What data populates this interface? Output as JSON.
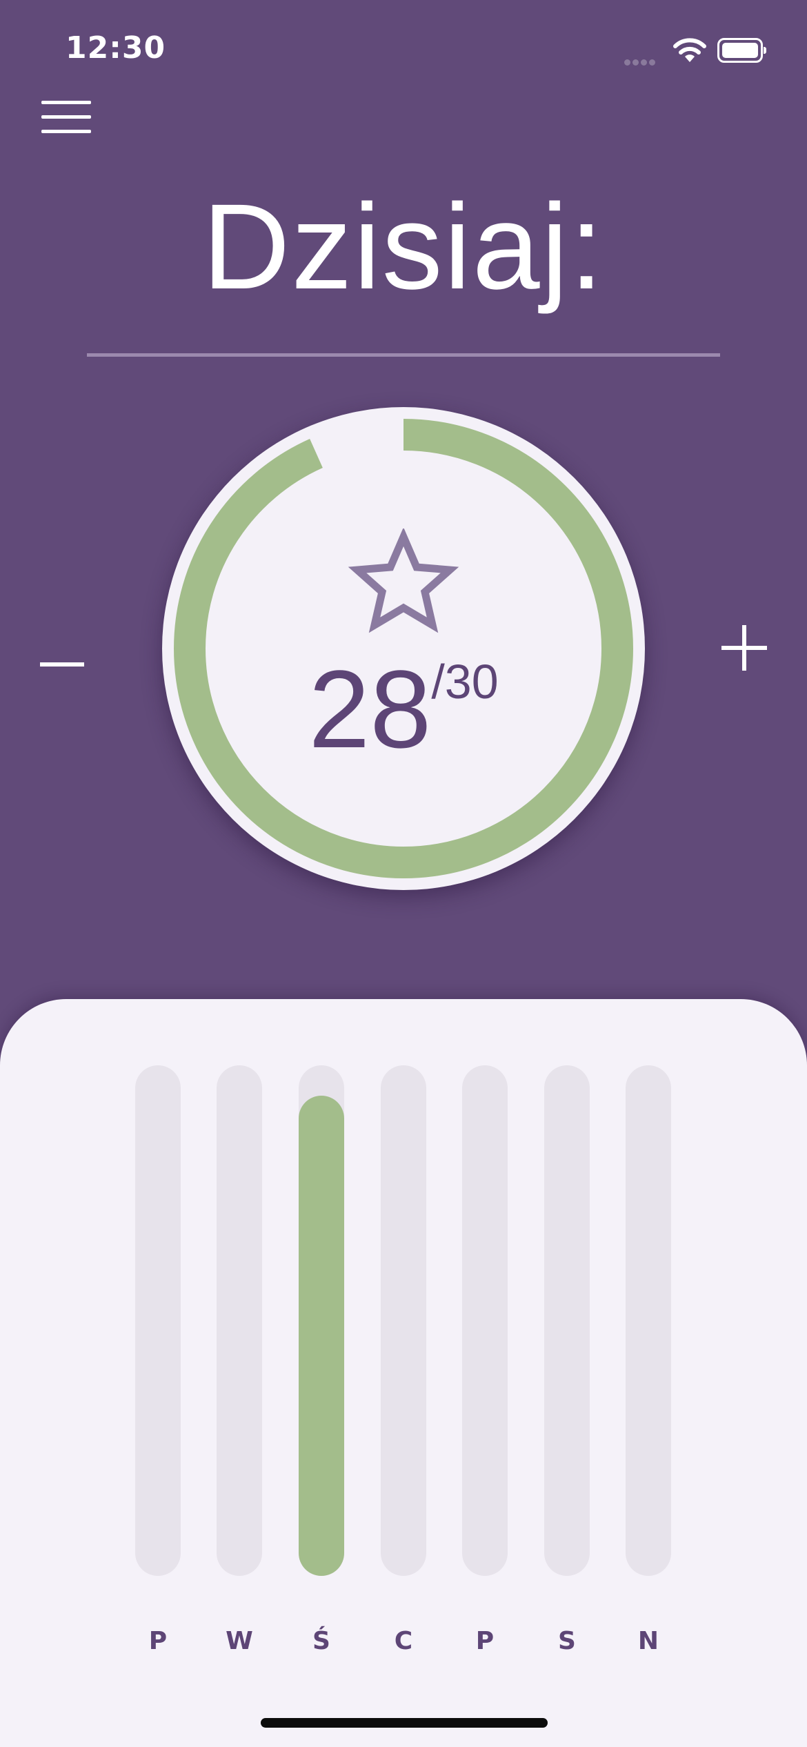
{
  "status_bar": {
    "time": "12:30"
  },
  "header": {
    "title": "Dzisiaj:"
  },
  "progress": {
    "count": "28",
    "goal": "/30",
    "fraction": 0.933,
    "ring_color": "#a3bd8b",
    "icon": "star-outline-icon"
  },
  "controls": {
    "decrement": "minus-icon",
    "increment": "plus-icon"
  },
  "weekly_history": {
    "days": [
      {
        "label": "P",
        "fill": 0.0
      },
      {
        "label": "W",
        "fill": 0.0
      },
      {
        "label": "Ś",
        "fill": 0.94
      },
      {
        "label": "C",
        "fill": 0.0
      },
      {
        "label": "P",
        "fill": 0.0
      },
      {
        "label": "S",
        "fill": 0.0
      },
      {
        "label": "N",
        "fill": 0.0
      }
    ],
    "fill_color": "#a3bd8b",
    "track_color": "#e7e3eb"
  },
  "theme": {
    "background": "#614a79",
    "accent_text": "#5d4576"
  }
}
